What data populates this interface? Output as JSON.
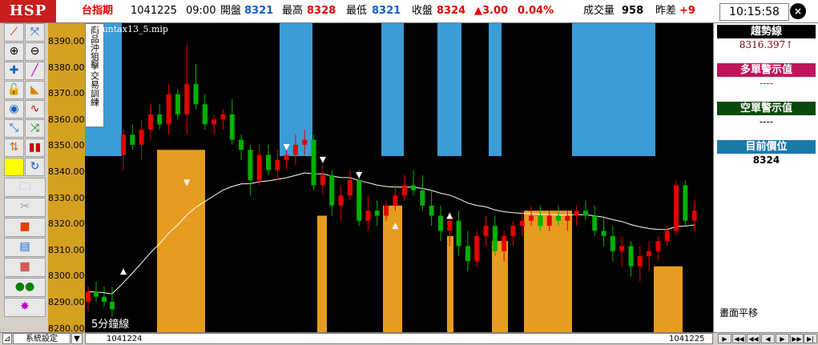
{
  "header": {
    "logo": "HSP",
    "market": "台指期",
    "date": "1041225",
    "time": "09:00",
    "open_label": "開盤",
    "open_value": "8321",
    "high_label": "最高",
    "high_value": "8328",
    "low_label": "最低",
    "low_value": "8321",
    "close_label": "收盤",
    "close_value": "8324",
    "change": "▲3.00",
    "change_pct": "0.04%",
    "volume_label": "成交量",
    "volume_value": "958",
    "diff_label": "昨差",
    "diff_value": "+9",
    "clock": "10:15:58",
    "close_icon": "×"
  },
  "chart": {
    "title": "Huntax13_5.mip",
    "period_label": "5分鐘線",
    "training_tab1": "商品沖狙擊",
    "training_tab2": "交易訓練",
    "y_ticks": [
      "8390.00",
      "8380.00",
      "8370.00",
      "8360.00",
      "8350.00",
      "8340.00",
      "8330.00",
      "8320.00",
      "8310.00",
      "8300.00",
      "8290.00",
      "8280.00"
    ],
    "x_start_label": "1041224",
    "x_end_label": "1041225"
  },
  "right_panel": {
    "trend_label": "趨勢線",
    "trend_value": "8316.397↑",
    "long_label": "多單警示值",
    "long_value": "----",
    "short_label": "空單警示值",
    "short_value": "----",
    "position_label": "目前價位",
    "position_value": "8324",
    "drawing_note": "畫面平移"
  },
  "bottom": {
    "settings_label": "系統設定",
    "arrow_label": "▼",
    "nav": [
      "▶",
      "◀◀",
      "◀◀",
      "◀",
      "▶",
      "▶▶",
      "▶|"
    ]
  },
  "toolbar_icons": [
    "line-draw-icon",
    "fit-icon",
    "zoom-in-icon",
    "zoom-out-icon",
    "crosshair-icon",
    "pencil-icon",
    "lock-icon",
    "ruler-icon",
    "scan-icon",
    "wave-icon",
    "indicator-icon",
    "swap-icon",
    "updown-icon",
    "candles-icon",
    "yellow-box-icon",
    "refresh-icon"
  ],
  "colors": {
    "up": "#e60000",
    "down": "#00b000",
    "blue_zone": "#3c9cd8",
    "orange_zone": "#e69c1e",
    "trend_line": "#ffffff"
  },
  "chart_data": {
    "type": "candlestick",
    "ylim": [
      8276,
      8398
    ],
    "candles": [
      [
        8288,
        8294,
        8284,
        8292
      ],
      [
        8292,
        8296,
        8288,
        8290
      ],
      [
        8290,
        8294,
        8286,
        8288
      ],
      [
        8288,
        8294,
        8282,
        8285
      ],
      [
        8346,
        8356,
        8340,
        8354
      ],
      [
        8354,
        8358,
        8348,
        8350
      ],
      [
        8350,
        8360,
        8344,
        8356
      ],
      [
        8356,
        8366,
        8352,
        8362
      ],
      [
        8362,
        8366,
        8356,
        8358
      ],
      [
        8358,
        8374,
        8354,
        8370
      ],
      [
        8370,
        8372,
        8360,
        8362
      ],
      [
        8362,
        8390,
        8354,
        8374
      ],
      [
        8374,
        8382,
        8364,
        8366
      ],
      [
        8366,
        8370,
        8356,
        8358
      ],
      [
        8358,
        8362,
        8354,
        8360
      ],
      [
        8360,
        8364,
        8356,
        8362
      ],
      [
        8362,
        8368,
        8350,
        8352
      ],
      [
        8352,
        8354,
        8344,
        8348
      ],
      [
        8348,
        8350,
        8330,
        8336
      ],
      [
        8336,
        8350,
        8334,
        8346
      ],
      [
        8346,
        8350,
        8338,
        8340
      ],
      [
        8340,
        8348,
        8336,
        8344
      ],
      [
        8344,
        8350,
        8340,
        8346
      ],
      [
        8346,
        8354,
        8342,
        8350
      ],
      [
        8350,
        8356,
        8346,
        8352
      ],
      [
        8352,
        8354,
        8332,
        8334
      ],
      [
        8334,
        8342,
        8330,
        8338
      ],
      [
        8338,
        8340,
        8322,
        8326
      ],
      [
        8326,
        8334,
        8320,
        8330
      ],
      [
        8330,
        8340,
        8328,
        8336
      ],
      [
        8336,
        8340,
        8318,
        8320
      ],
      [
        8320,
        8330,
        8316,
        8324
      ],
      [
        8324,
        8328,
        8318,
        8322
      ],
      [
        8322,
        8328,
        8320,
        8326
      ],
      [
        8326,
        8334,
        8324,
        8330
      ],
      [
        8330,
        8338,
        8328,
        8334
      ],
      [
        8334,
        8340,
        8330,
        8332
      ],
      [
        8332,
        8338,
        8324,
        8326
      ],
      [
        8326,
        8332,
        8318,
        8322
      ],
      [
        8322,
        8326,
        8312,
        8316
      ],
      [
        8316,
        8322,
        8310,
        8320
      ],
      [
        8320,
        8324,
        8306,
        8310
      ],
      [
        8310,
        8316,
        8300,
        8304
      ],
      [
        8304,
        8316,
        8302,
        8314
      ],
      [
        8314,
        8322,
        8310,
        8318
      ],
      [
        8318,
        8322,
        8306,
        8308
      ],
      [
        8308,
        8316,
        8304,
        8314
      ],
      [
        8314,
        8320,
        8310,
        8318
      ],
      [
        8318,
        8324,
        8314,
        8320
      ],
      [
        8320,
        8326,
        8318,
        8322
      ],
      [
        8322,
        8326,
        8316,
        8318
      ],
      [
        8318,
        8324,
        8316,
        8322
      ],
      [
        8322,
        8326,
        8318,
        8320
      ],
      [
        8320,
        8324,
        8316,
        8322
      ],
      [
        8322,
        8326,
        8318,
        8324
      ],
      [
        8324,
        8328,
        8320,
        8322
      ],
      [
        8322,
        8326,
        8314,
        8316
      ],
      [
        8316,
        8322,
        8310,
        8314
      ],
      [
        8314,
        8318,
        8304,
        8308
      ],
      [
        8308,
        8314,
        8302,
        8310
      ],
      [
        8310,
        8312,
        8298,
        8302
      ],
      [
        8302,
        8310,
        8296,
        8306
      ],
      [
        8306,
        8312,
        8300,
        8308
      ],
      [
        8308,
        8314,
        8304,
        8312
      ],
      [
        8312,
        8318,
        8310,
        8316
      ],
      [
        8316,
        8336,
        8314,
        8334
      ],
      [
        8334,
        8336,
        8318,
        8320
      ],
      [
        8320,
        8328,
        8316,
        8324
      ]
    ]
  }
}
